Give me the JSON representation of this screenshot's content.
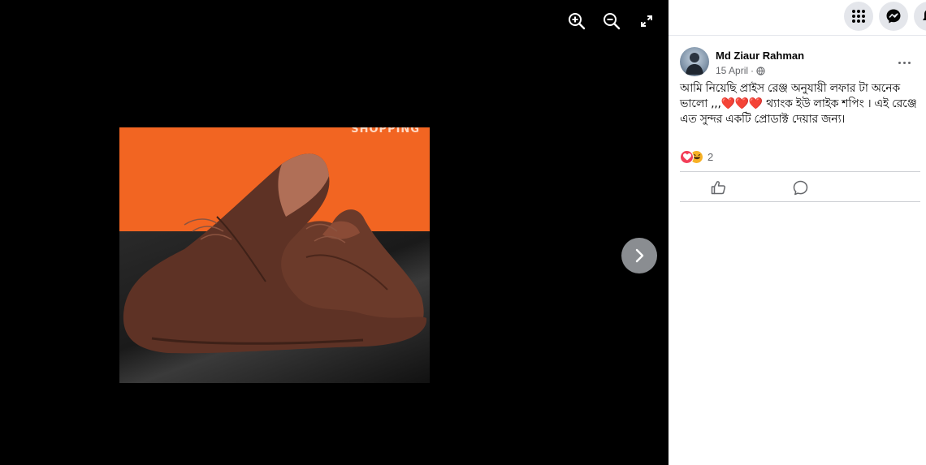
{
  "viewer": {
    "zoom_in_icon": "zoom-in-icon",
    "zoom_out_icon": "zoom-out-icon",
    "fullscreen_icon": "fullscreen-icon",
    "next_icon": "chevron-right-icon",
    "photo_watermark": "SHOPPING"
  },
  "topbar": {
    "menu_icon": "grid-menu-icon",
    "messenger_icon": "messenger-icon",
    "notifications_icon": "bell-icon"
  },
  "post": {
    "author": "Md Ziaur Rahman",
    "date": "15 April",
    "separator": "·",
    "privacy_icon": "globe-icon",
    "text_part1": "আমি নিয়েছি প্রাইস রেঞ্জ অনুযায়ী লফার টা অনেক ভালো ,,,",
    "hearts": "❤️❤️❤️",
    "text_part2": " থ্যাংক ইউ লাইক শপিং । এই রেঞ্জে এত সুন্দর একটি প্রোডাক্ট দেয়ার জন্য।",
    "reaction_count": "2",
    "reaction_icons": [
      "love-reaction-icon",
      "haha-reaction-icon"
    ],
    "like_icon": "like-icon",
    "comment_icon": "comment-icon"
  },
  "colors": {
    "photo_background": "#f26522",
    "panel_background": "#ffffff",
    "viewer_background": "#000000",
    "love_reaction": "#f33e58",
    "haha_reaction": "#f7b125"
  }
}
